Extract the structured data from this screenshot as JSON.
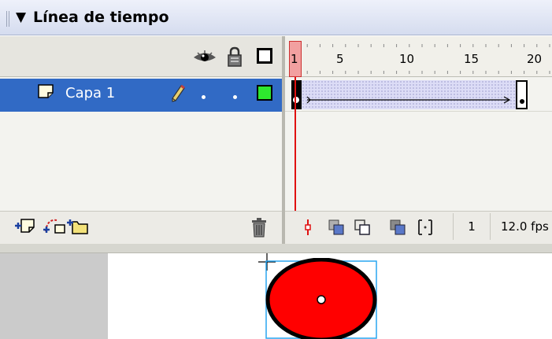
{
  "panel": {
    "title": "Línea de tiempo",
    "collapse_glyph": "▼"
  },
  "layers": {
    "header_icons": [
      "eye-icon",
      "lock-icon",
      "outline-icon"
    ],
    "items": [
      {
        "name": "Capa 1",
        "selected": true,
        "outline_color": "#2ee82e"
      }
    ],
    "footer_icons": [
      "add-layer-icon",
      "add-motion-guide-icon",
      "add-layer-folder-icon",
      "delete-layer-icon"
    ]
  },
  "timeline": {
    "ruler_labels": [
      "1",
      "5",
      "10",
      "15",
      "20"
    ],
    "current_frame": "1",
    "frame_rate": "12.0 fps",
    "tween": "motion",
    "playhead_color": "#e01010",
    "tween_color": "#dcdcf6"
  },
  "colors": {
    "selection": "#316ac5",
    "shape_fill": "#ff0000",
    "bounding_box": "#29a6f0"
  }
}
